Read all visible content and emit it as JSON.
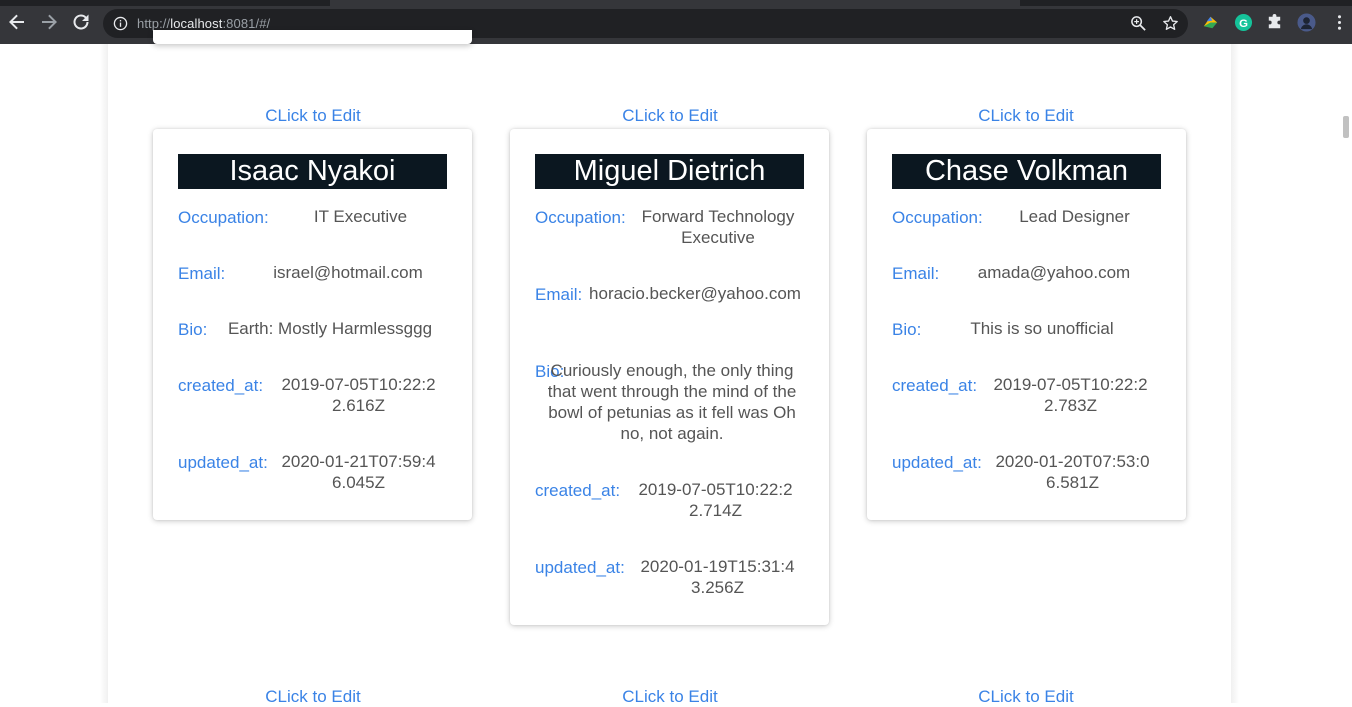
{
  "browser": {
    "url_prefix": "http://",
    "url_host": "localhost",
    "url_suffix": ":8081/#/"
  },
  "edit_link_label": "CLick to Edit",
  "labels": {
    "occupation": "Occupation:",
    "email": "Email:",
    "bio": "Bio:",
    "created_at": "created_at:",
    "updated_at": "updated_at:"
  },
  "cards": [
    {
      "name": "Isaac Nyakoi",
      "occupation": "IT Executive",
      "email": "israel@hotmail.com",
      "bio": "Earth: Mostly Harmlessggg",
      "created_at": "2019-07-05T10:22:22.616Z",
      "updated_at": "2020-01-21T07:59:46.045Z"
    },
    {
      "name": "Miguel Dietrich",
      "occupation": "Forward Technology Executive",
      "email": "horacio.becker@yahoo.com",
      "bio": "Curiously enough, the only thing that went through the mind of the bowl of petunias as it fell was Oh no, not again.",
      "created_at": "2019-07-05T10:22:22.714Z",
      "updated_at": "2020-01-19T15:31:43.256Z"
    },
    {
      "name": "Chase Volkman",
      "occupation": "Lead Designer",
      "email": "amada@yahoo.com",
      "bio": "This is so unofficial",
      "created_at": "2019-07-05T10:22:22.783Z",
      "updated_at": "2020-01-20T07:53:06.581Z"
    }
  ],
  "colors": {
    "link": "#3a83e6",
    "name_bar": "#0b1720",
    "value_text": "#555555",
    "chrome_bg": "#35363a",
    "omnibox_bg": "#202124"
  }
}
